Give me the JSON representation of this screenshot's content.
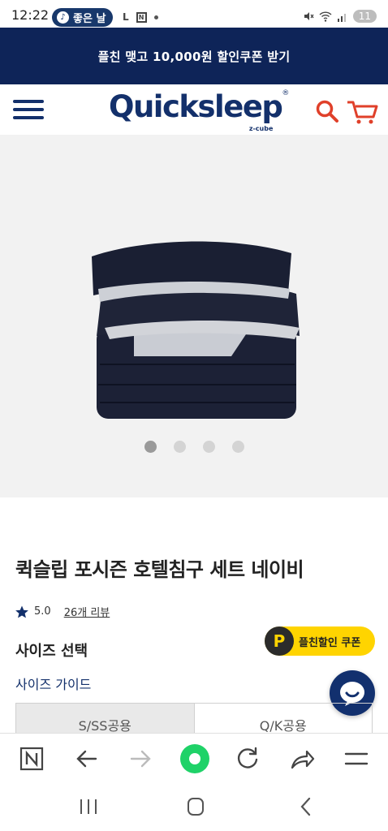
{
  "status_bar": {
    "time": "12:22",
    "pill_label": "좋은 날",
    "pill_icon": "music-note-icon",
    "left_icons": [
      "L",
      "N"
    ],
    "battery": "11"
  },
  "promo_banner": {
    "text": "플친 맺고 10,000원 할인쿠폰 받기"
  },
  "header": {
    "logo_text": "Quicksleep",
    "logo_reg": "®",
    "logo_sub": "z-cube"
  },
  "gallery": {
    "slide_count": 4,
    "active_slide": 1
  },
  "product": {
    "title": "퀵슬립 포시즌 호텔침구 세트 네이비",
    "rating": "5.0",
    "reviews": "26개 리뷰",
    "size_select_label": "사이즈 선택",
    "size_guide_label": "사이즈 가이드",
    "coupon_p": "P",
    "coupon_label": "플친할인 쿠폰",
    "size_options": [
      "S/SS공용",
      "Q/K공용"
    ]
  },
  "colors": {
    "brand_navy": "#13306b",
    "promo_bg": "#0e2458",
    "coupon_yellow": "#ffd400",
    "browser_green": "#1fd268"
  }
}
